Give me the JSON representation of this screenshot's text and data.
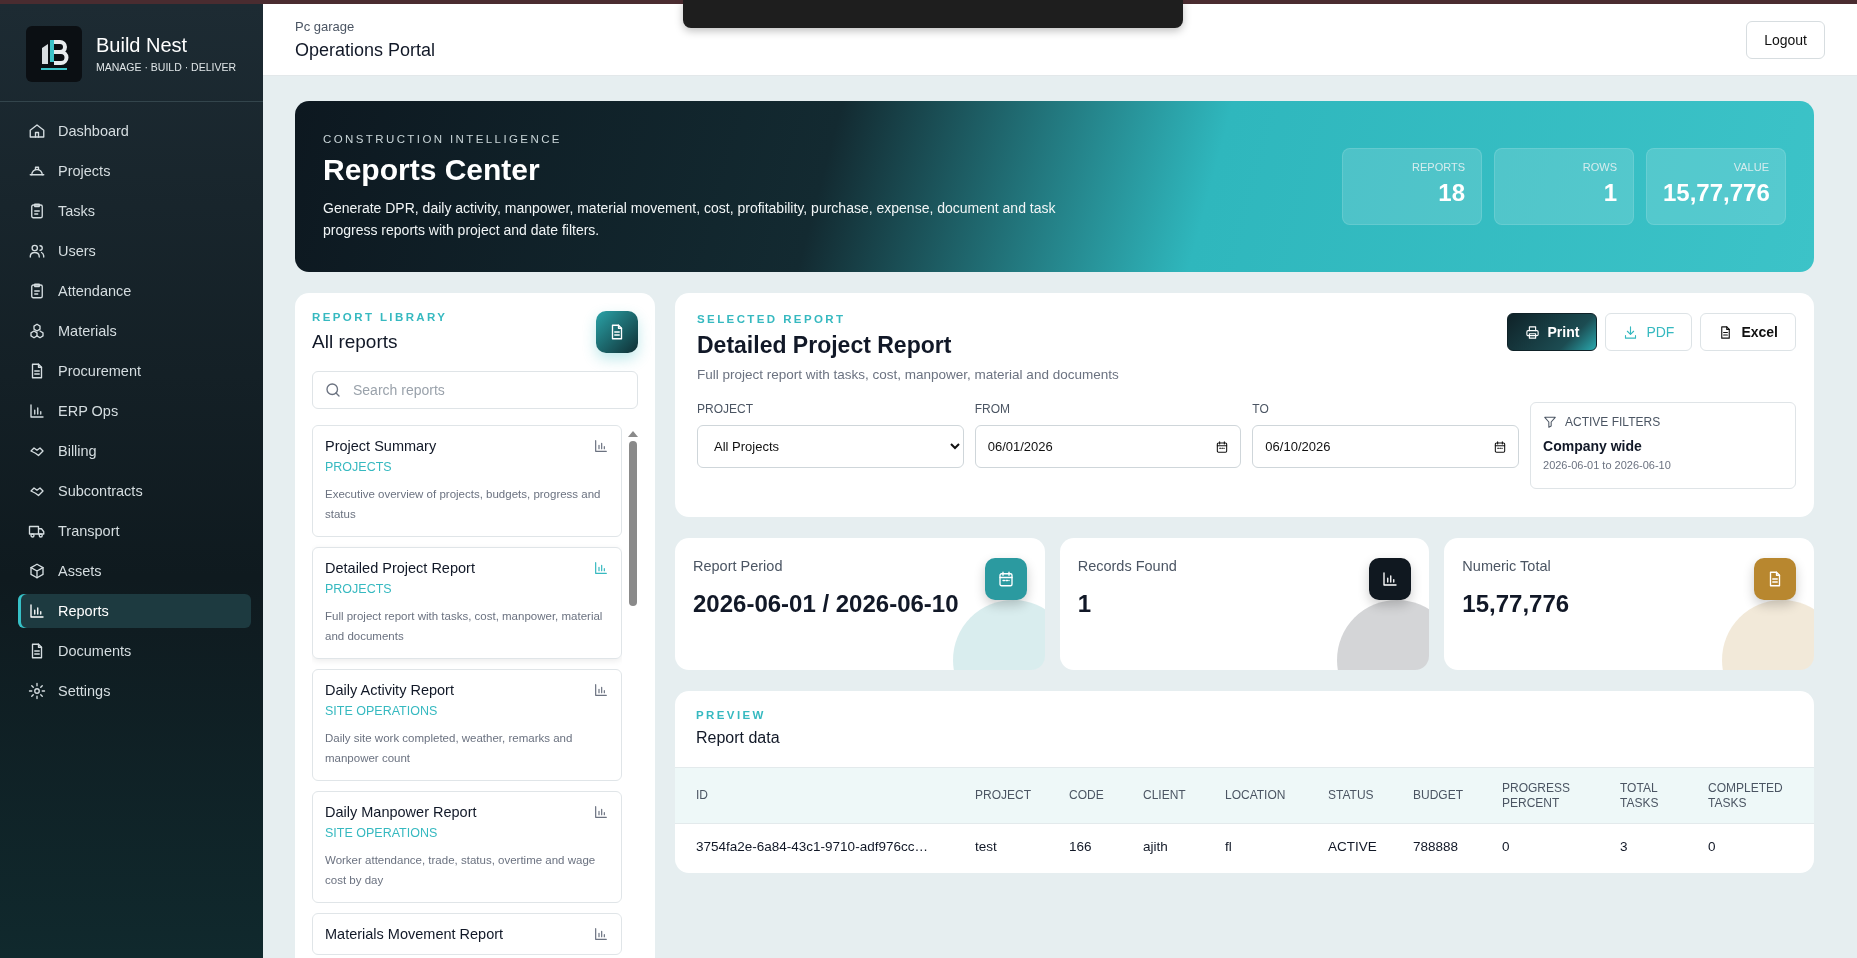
{
  "brand": {
    "name": "Build Nest",
    "tagline": "MANAGE · BUILD · DELIVER"
  },
  "sidebar": {
    "items": [
      {
        "label": "Dashboard",
        "selected": false
      },
      {
        "label": "Projects",
        "selected": false
      },
      {
        "label": "Tasks",
        "selected": false
      },
      {
        "label": "Users",
        "selected": false
      },
      {
        "label": "Attendance",
        "selected": false
      },
      {
        "label": "Materials",
        "selected": false
      },
      {
        "label": "Procurement",
        "selected": false
      },
      {
        "label": "ERP Ops",
        "selected": false
      },
      {
        "label": "Billing",
        "selected": false
      },
      {
        "label": "Subcontracts",
        "selected": false
      },
      {
        "label": "Transport",
        "selected": false
      },
      {
        "label": "Assets",
        "selected": false
      },
      {
        "label": "Reports",
        "selected": true
      },
      {
        "label": "Documents",
        "selected": false
      },
      {
        "label": "Settings",
        "selected": false
      }
    ]
  },
  "header": {
    "subtitle": "Pc garage",
    "title": "Operations Portal",
    "logout": "Logout"
  },
  "hero": {
    "eyebrow": "CONSTRUCTION INTELLIGENCE",
    "title": "Reports Center",
    "description": "Generate DPR, daily activity, manpower, material movement, cost, profitability, purchase, expense, document and task progress reports with project and date filters.",
    "stats": [
      {
        "label": "REPORTS",
        "value": "18"
      },
      {
        "label": "ROWS",
        "value": "1"
      },
      {
        "label": "VALUE",
        "value": "15,77,776"
      }
    ]
  },
  "library": {
    "eyebrow": "REPORT LIBRARY",
    "title": "All reports",
    "search": {
      "placeholder": "Search reports"
    },
    "reports": [
      {
        "title": "Project Summary",
        "category": "PROJECTS",
        "description": "Executive overview of projects, budgets, progress and status",
        "selected": false
      },
      {
        "title": "Detailed Project Report",
        "category": "PROJECTS",
        "description": "Full project report with tasks, cost, manpower, material and documents",
        "selected": true
      },
      {
        "title": "Daily Activity Report",
        "category": "SITE OPERATIONS",
        "description": "Daily site work completed, weather, remarks and manpower count",
        "selected": false
      },
      {
        "title": "Daily Manpower Report",
        "category": "SITE OPERATIONS",
        "description": "Worker attendance, trade, status, overtime and wage cost by day",
        "selected": false
      },
      {
        "title": "Materials Movement Report",
        "selected": false
      }
    ]
  },
  "selected_report": {
    "eyebrow": "SELECTED REPORT",
    "title": "Detailed Project Report",
    "description": "Full project report with tasks, cost, manpower, material and documents",
    "actions": [
      {
        "label": "Print",
        "kind": "primary"
      },
      {
        "label": "PDF",
        "kind": "outline"
      },
      {
        "label": "Excel",
        "kind": "plain"
      }
    ],
    "filters": [
      {
        "label": "PROJECT",
        "kind": "select",
        "value": "All Projects"
      },
      {
        "label": "FROM",
        "kind": "date",
        "value": "06/01/2026"
      },
      {
        "label": "TO",
        "kind": "date",
        "value": "06/10/2026"
      }
    ],
    "active_filters": {
      "label": "ACTIVE FILTERS",
      "title": "Company wide",
      "range": "2026-06-01 to 2026-06-10"
    }
  },
  "metrics": [
    {
      "label": "Report Period",
      "value": "2026-06-01 / 2026-06-10",
      "color": "#2b9aa0"
    },
    {
      "label": "Records Found",
      "value": "1",
      "color": "#101820"
    },
    {
      "label": "Numeric Total",
      "value": "15,77,776",
      "color": "#b8872f"
    }
  ],
  "preview": {
    "eyebrow": "PREVIEW",
    "title": "Report data",
    "table": {
      "columns": [
        "ID",
        "PROJECT",
        "CODE",
        "CLIENT",
        "LOCATION",
        "STATUS",
        "BUDGET",
        "PROGRESS PERCENT",
        "TOTAL TASKS",
        "COMPLETED TASKS"
      ],
      "rows": [
        [
          "3754fa2e-6a84-43c1-9710-adf976cc…",
          "test",
          "166",
          "ajith",
          "fl",
          "ACTIVE",
          "788888",
          "0",
          "3",
          "0"
        ]
      ]
    }
  }
}
